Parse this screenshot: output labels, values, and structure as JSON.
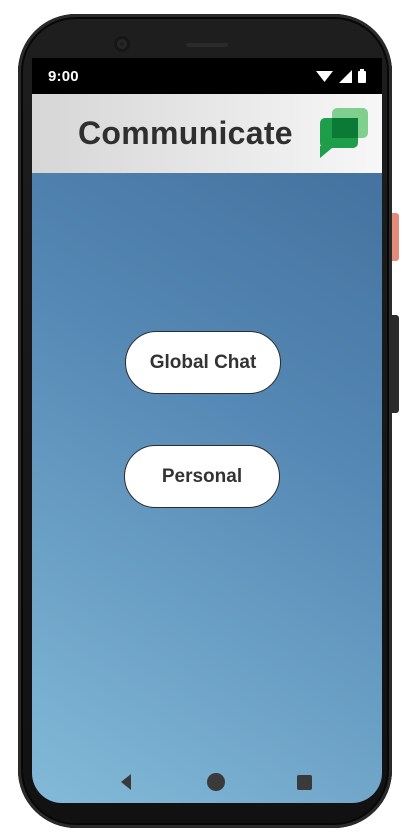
{
  "status_bar": {
    "time": "9:00",
    "icons": [
      "wifi-icon",
      "cell-signal-icon",
      "battery-icon"
    ]
  },
  "header": {
    "title": "Communicate",
    "logo_icon": "chat-bubbles-icon",
    "logo_colors": [
      "#1e9e4a",
      "#7fd08f",
      "#0b7a34"
    ]
  },
  "main": {
    "buttons": [
      {
        "label": "Global Chat"
      },
      {
        "label": "Personal"
      }
    ]
  },
  "nav": {
    "icons": [
      "back-icon",
      "home-icon",
      "recents-icon"
    ]
  },
  "colors": {
    "background_top": "#3f6a98",
    "background_bottom": "#83bad8",
    "header_gradient_start": "#d6d6d6",
    "header_gradient_end": "#f7f7f7",
    "title_text": "#2f2f2f"
  }
}
